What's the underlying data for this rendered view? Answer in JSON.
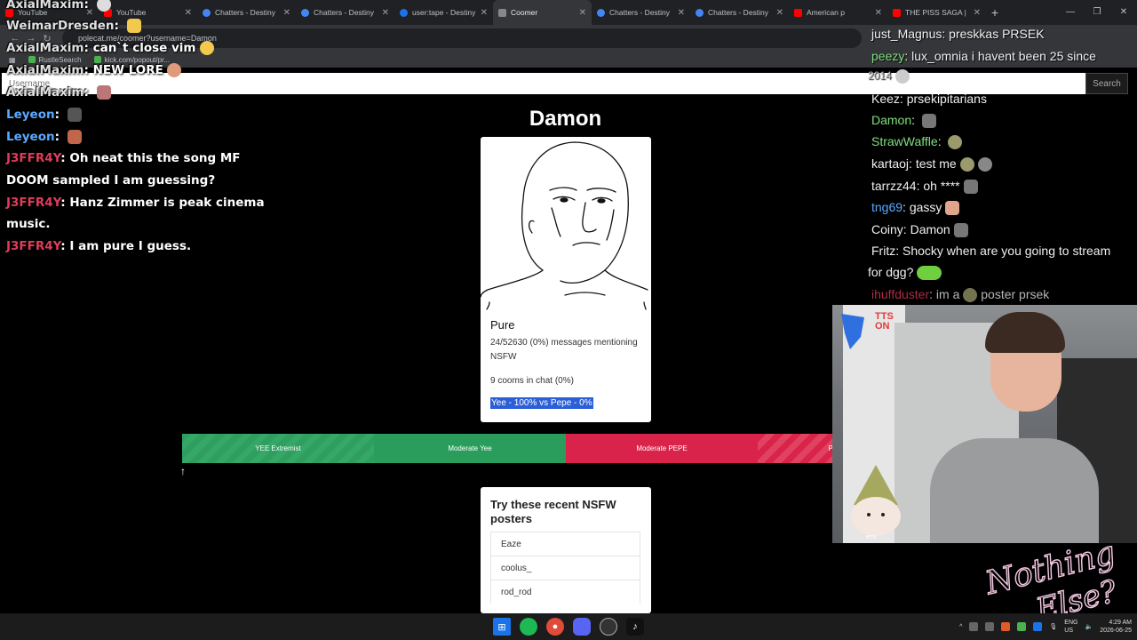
{
  "browser": {
    "tabs": [
      {
        "title": "YouTube",
        "favicon": "youtube-icon"
      },
      {
        "title": "YouTube",
        "favicon": "youtube-icon"
      },
      {
        "title": "Chatters - Destiny",
        "favicon": "globe-icon"
      },
      {
        "title": "Chatters - Destiny",
        "favicon": "globe-icon"
      },
      {
        "title": "user:tape - Destiny",
        "favicon": "dgg-icon"
      },
      {
        "title": "Coomer",
        "favicon": "coomer-icon"
      },
      {
        "title": "Chatters - Destiny",
        "favicon": "globe-icon"
      },
      {
        "title": "Chatters - Destiny",
        "favicon": "globe-icon"
      },
      {
        "title": "American p",
        "favicon": "youtube-icon"
      },
      {
        "title": "THE PISS SAGA |",
        "favicon": "youtube-icon"
      }
    ],
    "active_tab_index": 5,
    "new_tab": "+",
    "url": "polecat.me/coomer?username=Damon",
    "bookmarks": [
      "RustleSearch",
      "kick.com/popout/pr..."
    ]
  },
  "page": {
    "search": {
      "placeholder": "Username",
      "button": "Search"
    },
    "username": "Damon",
    "card": {
      "status": "Pure",
      "messages_stat": "24/52630 (0%) messages mentioning NSFW",
      "cooms_stat": "9 cooms in chat (0%)",
      "ratio": "Yee - 100% vs Pepe - 0%"
    },
    "scale": {
      "segments": [
        "YEE Extremist",
        "Moderate Yee",
        "Moderate PEPE",
        "P"
      ],
      "pointer": "↑"
    },
    "recent": {
      "title": "Try these recent NSFW posters",
      "items": [
        "Eaze",
        "coolus_",
        "rod_rod"
      ]
    }
  },
  "left_chat": [
    {
      "user": "AxialMaxim",
      "text": ""
    },
    {
      "user": "WeimarDresden",
      "text": ""
    },
    {
      "user": "AxialMaxim",
      "text": "can`t close vim"
    },
    {
      "user": "AxialMaxim",
      "text": "NEW LORE"
    },
    {
      "user": "AxialMaxim",
      "text": ""
    },
    {
      "user": "Leyeon",
      "text": ""
    },
    {
      "user": "Leyeon",
      "text": ""
    },
    {
      "user": "J3FFR4Y",
      "text": "Oh neat this the song MF"
    },
    {
      "user": "",
      "text": "DOOM sampled I am guessing?"
    },
    {
      "user": "J3FFR4Y",
      "text": "Hanz Zimmer is peak cinema"
    },
    {
      "user": "",
      "text": "music."
    },
    {
      "user": "J3FFR4Y",
      "text": "I am pure I guess."
    }
  ],
  "right_chat": [
    {
      "user": "just_Magnus",
      "text": "preskkas PRSEK",
      "color": "#ffffff"
    },
    {
      "user": "peezy",
      "text": "lux_omnia i havent been 25 since",
      "color": "#7ee07e"
    },
    {
      "user": "",
      "text": "2014",
      "color": "#ffffff"
    },
    {
      "user": "Keez",
      "text": "prsekipitarians",
      "color": "#ffffff"
    },
    {
      "user": "Damon",
      "text": "",
      "color": "#7ee07e"
    },
    {
      "user": "StrawWaffle",
      "text": "",
      "color": "#7ee07e"
    },
    {
      "user": "kartaoj",
      "text": "test me",
      "color": "#ffffff"
    },
    {
      "user": "tarrzz44",
      "text": "oh ****",
      "color": "#ffffff"
    },
    {
      "user": "tng69",
      "text": "gassy",
      "color": "#5aa9ff"
    },
    {
      "user": "Coiny",
      "text": "Damon",
      "color": "#ffffff"
    },
    {
      "user": "Fritz",
      "text": "Shocky when are you going to stream",
      "color": "#ffffff"
    },
    {
      "user": "",
      "text": "for dgg?",
      "color": "#ffffff"
    },
    {
      "user": "ihuffduster",
      "text": "im a",
      "color": "#e23b5a"
    },
    {
      "user": "",
      "text": "poster prsek",
      "color": "#ffffff"
    }
  ],
  "webcam": {
    "tts_badge": "TTS ON",
    "overlay_label": "emi"
  },
  "logo": {
    "text_line1": "Nothing",
    "text_line2": "Else?",
    "color": "#f4c9e2"
  },
  "taskbar": {
    "icons": [
      "windows-icon",
      "spotify-icon",
      "chrome-icon",
      "discord-icon",
      "obs-icon",
      "tiktok-icon"
    ],
    "tray": {
      "lang": "ENG",
      "region": "US",
      "time": "4:29 AM",
      "date": "2026-06-25"
    }
  },
  "colors": {
    "yee_green": "#2a9d5c",
    "pepe_red": "#d9234a",
    "selection_blue": "#2b5fd9"
  }
}
